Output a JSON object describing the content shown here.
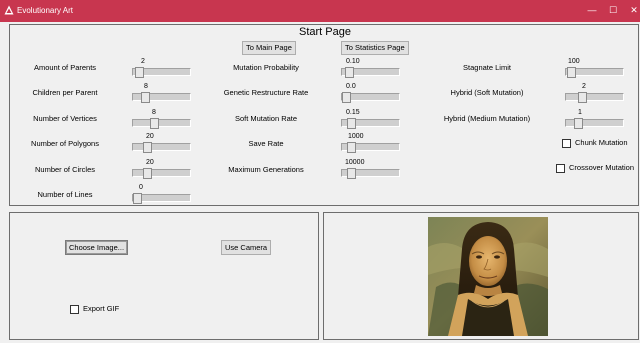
{
  "window": {
    "title": "Evolutionary Art",
    "titlebar_color": "#c8364f",
    "controls": [
      "minimize-icon",
      "maximize-icon",
      "close-icon"
    ]
  },
  "page": {
    "heading": "Start Page",
    "buttons": {
      "main": "To Main Page",
      "stats": "To Statistics Page"
    }
  },
  "parameters": {
    "col1": [
      {
        "label": "Amount of Parents",
        "value": "2"
      },
      {
        "label": "Children per Parent",
        "value": "8"
      },
      {
        "label": "Number of Vertices",
        "value": "8"
      },
      {
        "label": "Number of Polygons",
        "value": "20"
      },
      {
        "label": "Number of Circles",
        "value": "20"
      },
      {
        "label": "Number of Lines",
        "value": "0"
      }
    ],
    "col2": [
      {
        "label": "Mutation Probability",
        "value": "0.10"
      },
      {
        "label": "Genetic Restructure Rate",
        "value": "0.0"
      },
      {
        "label": "Soft Mutation Rate",
        "value": "0.15"
      },
      {
        "label": "Save Rate",
        "value": "1000"
      },
      {
        "label": "Maximum Generations",
        "value": "10000"
      }
    ],
    "col3": [
      {
        "label": "Stagnate Limit",
        "value": "100"
      },
      {
        "label": "Hybrid (Soft Mutation)",
        "value": "2"
      },
      {
        "label": "Hybrid (Medium Mutation)",
        "value": "1"
      }
    ]
  },
  "checkboxes": {
    "chunk": {
      "label": "Chunk Mutation",
      "checked": false
    },
    "crossover": {
      "label": "Crossover Mutation",
      "checked": false
    },
    "export_gif": {
      "label": "Export GIF",
      "checked": false
    }
  },
  "image_controls": {
    "choose": "Choose Image...",
    "camera": "Use Camera"
  }
}
